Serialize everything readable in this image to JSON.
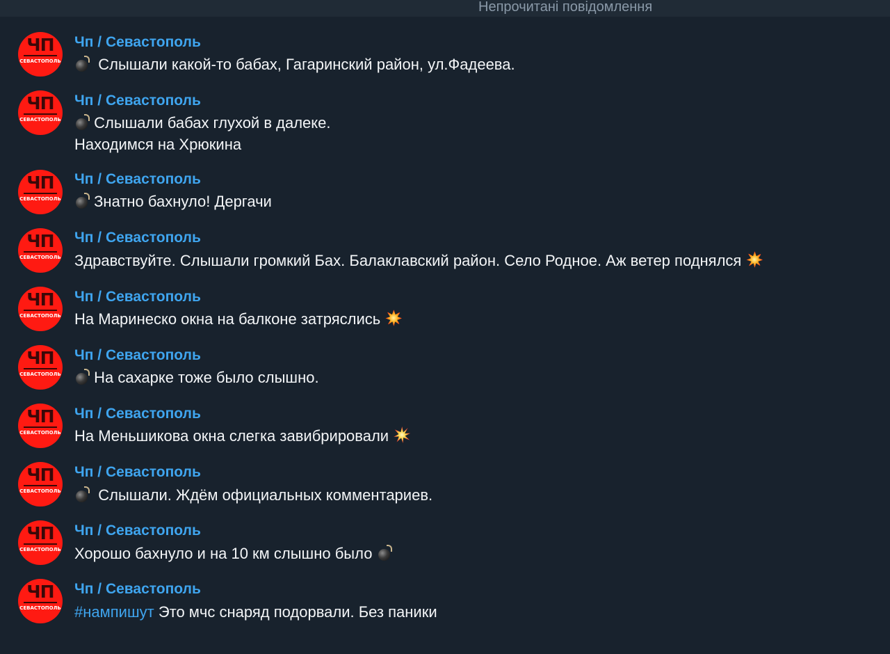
{
  "unread_bar": {
    "label": "Непрочитані повідомлення"
  },
  "avatar": {
    "big": "ЧП",
    "small": "СЕВАСТОПОЛЬ"
  },
  "icons": {
    "bomb": "bomb-icon",
    "boom": "boom-icon",
    "collision": "collision-icon"
  },
  "colors": {
    "sender": "#3fa5ef",
    "hashtag": "#3fa5ef",
    "avatar": "#ff1a12",
    "background": "#18222d"
  },
  "messages": [
    {
      "sender": "Чп / Севастополь",
      "lines": [
        "Слышали какой-то бабах, Гагаринский район, ул.Фадеева."
      ]
    },
    {
      "sender": "Чп / Севастополь",
      "lines": [
        "Слышали бабах глухой в далеке.",
        "Находимся на Хрюкина"
      ]
    },
    {
      "sender": "Чп / Севастополь",
      "lines": [
        "Знатно бахнуло! Дергачи"
      ]
    },
    {
      "sender": "Чп / Севастополь",
      "lines": [
        "Здравствуйте. Слышали громкий Бах. Балаклавский район. Село Родное. Аж ветер поднялся"
      ]
    },
    {
      "sender": "Чп / Севастополь",
      "lines": [
        "На Маринеско окна на балконе затряслись"
      ]
    },
    {
      "sender": "Чп / Севастополь",
      "lines": [
        "На сахарке тоже было слышно."
      ]
    },
    {
      "sender": "Чп / Севастополь",
      "lines": [
        "На Меньшикова окна слегка завибрировали"
      ]
    },
    {
      "sender": "Чп / Севастополь",
      "lines": [
        "Слышали. Ждём официальных комментариев."
      ]
    },
    {
      "sender": "Чп / Севастополь",
      "lines": [
        "Хорошо бахнуло и на 10 км слышно было"
      ]
    },
    {
      "sender": "Чп / Севастополь",
      "hashtag": "#нампишут",
      "lines": [
        "Это мчс снаряд подорвали. Без паники"
      ]
    }
  ]
}
